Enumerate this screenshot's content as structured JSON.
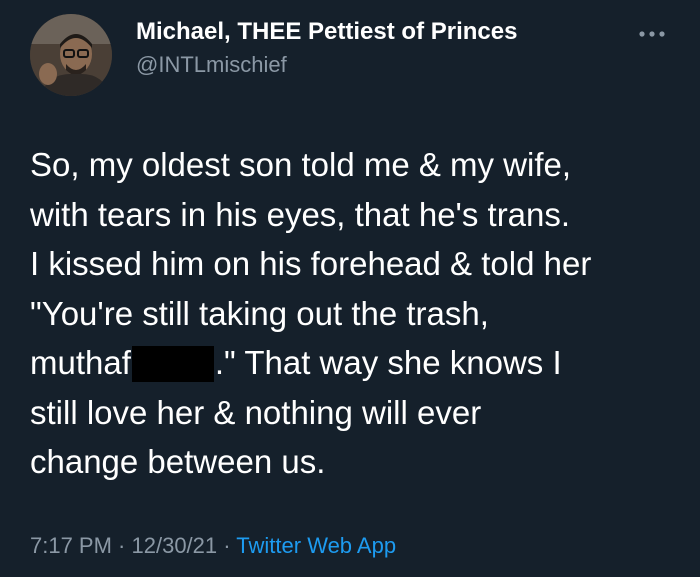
{
  "tweet": {
    "display_name": "Michael, THEE Pettiest of Princes",
    "handle": "@INTLmischief",
    "more_icon": "more-horizontal-icon",
    "body_lines": [
      "So, my oldest son told me & my wife,",
      "with tears in his eyes, that he's trans.",
      "I kissed him on his forehead & told her",
      "\"You're still taking out the trash,"
    ],
    "line5_before": "muthaf",
    "line5_after": ".\" That way she knows I",
    "body_lines_end": [
      "still love her & nothing will ever",
      "change between us."
    ],
    "time": "7:17 PM",
    "sep1": " · ",
    "date": "12/30/21",
    "sep2": " · ",
    "source": "Twitter Web App"
  },
  "colors": {
    "background": "#15202b",
    "text": "#ffffff",
    "secondary": "#8b98a5",
    "link": "#1d9bf0",
    "redaction": "#000000"
  }
}
